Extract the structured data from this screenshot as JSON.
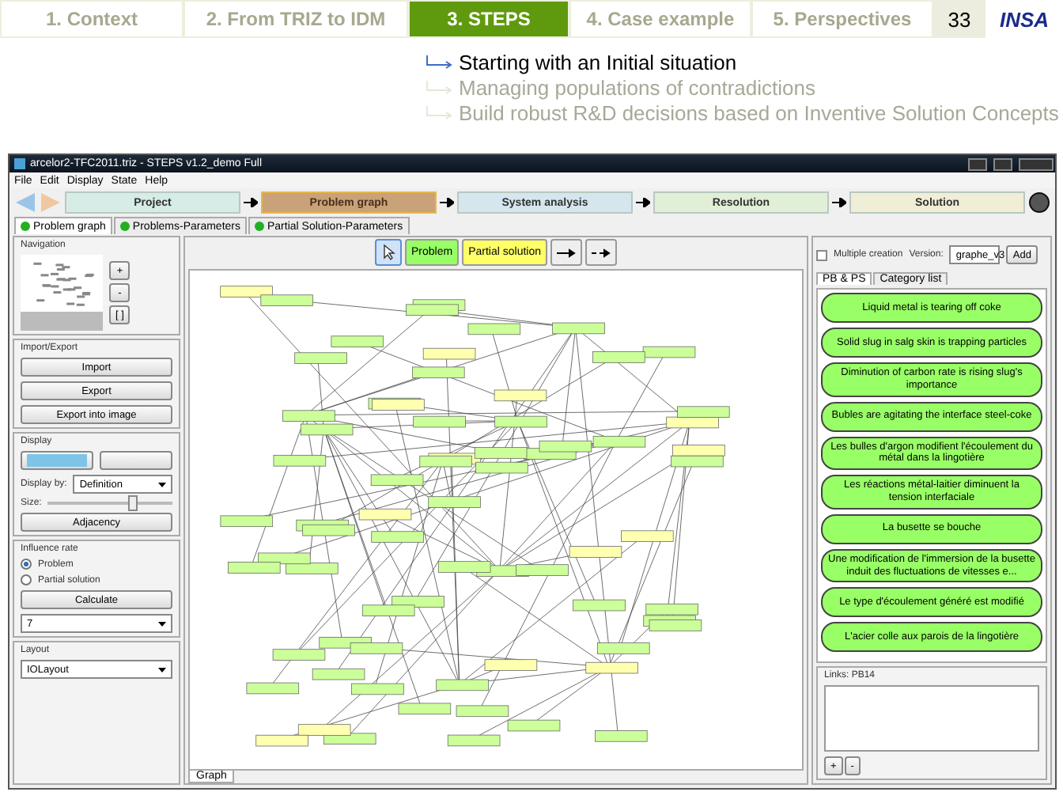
{
  "slide_nav": {
    "tabs": [
      {
        "label": "1. Context",
        "selected": false
      },
      {
        "label": "2. From TRIZ to IDM",
        "selected": false
      },
      {
        "label": "3. STEPS",
        "selected": true
      },
      {
        "label": "4. Case example",
        "selected": false
      },
      {
        "label": "5. Perspectives",
        "selected": false
      }
    ],
    "page_number": "33",
    "logo": "INSA"
  },
  "bullets": [
    {
      "text": "Starting with an Initial situation",
      "selected": true
    },
    {
      "text": "Managing populations of contradictions",
      "selected": false
    },
    {
      "text": "Build robust R&D decisions based on Inventive Solution Concepts",
      "selected": false
    }
  ],
  "window": {
    "title": "arcelor2-TFC2011.triz - STEPS v1.2_demo Full",
    "menu": [
      "File",
      "Edit",
      "Display",
      "State",
      "Help"
    ],
    "steps": [
      {
        "label": "Project",
        "selected": false,
        "color": "#d6ece6"
      },
      {
        "label": "Problem graph",
        "selected": true,
        "color": "#c9a27a"
      },
      {
        "label": "System analysis",
        "selected": false,
        "color": "#d5e6ee"
      },
      {
        "label": "Resolution",
        "selected": false,
        "color": "#e0efd6"
      },
      {
        "label": "Solution",
        "selected": false,
        "color": "#f0eed6"
      }
    ],
    "tabs": [
      {
        "label": "Problem graph",
        "selected": true
      },
      {
        "label": "Problems-Parameters",
        "selected": false
      },
      {
        "label": "Partial Solution-Parameters",
        "selected": false
      }
    ]
  },
  "left_panel": {
    "navigation": {
      "title": "Navigation",
      "zoom_buttons": [
        "+",
        "-",
        "[ ]"
      ]
    },
    "import_export": {
      "title": "Import/Export",
      "buttons": [
        "Import",
        "Export",
        "Export into image"
      ]
    },
    "display": {
      "title": "Display",
      "toggles": [
        {
          "selected": true
        },
        {
          "selected": false
        }
      ],
      "display_by_label": "Display by:",
      "display_by": "Definition",
      "size_label": "Size:",
      "size": {
        "level": 0.68
      },
      "button": "Adjacency"
    },
    "influence_rate": {
      "title": "Influence rate",
      "options": [
        {
          "label": "Problem",
          "selected": true
        },
        {
          "label": "Partial solution",
          "selected": false
        }
      ],
      "button": "Calculate",
      "value": "7"
    },
    "layout": {
      "title": "Layout",
      "value": "IOLayout"
    }
  },
  "toolbar": {
    "tools": [
      {
        "kind": "pointer",
        "selected": true
      },
      {
        "kind": "problem",
        "label": "Problem",
        "selected": false
      },
      {
        "kind": "partial",
        "label": "Partial solution",
        "selected": false
      },
      {
        "kind": "arrow",
        "selected": false
      },
      {
        "kind": "dashed",
        "selected": false
      }
    ],
    "multiple_creation": {
      "label": "Multiple creation",
      "checked": false
    },
    "version_label": "Version:",
    "version": "graphe_v3",
    "add": "Add"
  },
  "graph_tab": "Graph",
  "right_panel": {
    "tabs": [
      {
        "label": "PB & PS",
        "selected": true
      },
      {
        "label": "Category list",
        "selected": false
      }
    ],
    "items": [
      "Liquid metal is tearing off coke",
      "Solid slug in salg skin is trapping particles",
      "Diminution of carbon rate is rising slug's importance",
      "Bubles are agitating the interface steel-coke",
      "Les bulles d'argon modifient l'écoulement du métal dans la lingotière",
      "Les réactions métal-laitier diminuent la tension interfaciale",
      "La busette se bouche",
      "Une modification de l'immersion de la busette induit des fluctuations de vitesses e...",
      "Le type d'écoulement généré est modifié",
      "L'acier colle aux parois de la lingotière"
    ],
    "links_title": "Links: PB14",
    "link_buttons": [
      "+",
      "-"
    ]
  }
}
